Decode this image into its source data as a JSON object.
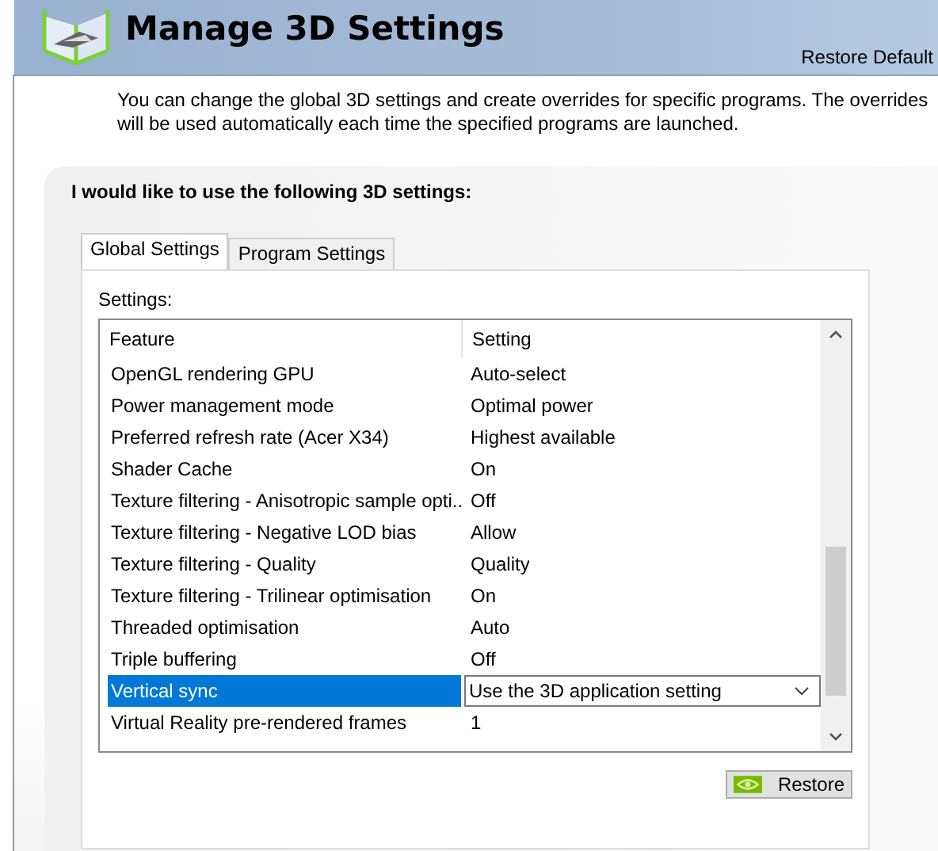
{
  "header": {
    "title": "Manage 3D Settings",
    "restore_link": "Restore Default"
  },
  "description": "You can change the global 3D settings and create overrides for specific programs. The overrides will be used automatically each time the specified programs are launched.",
  "panel": {
    "heading": "I would like to use the following 3D settings:",
    "tabs": [
      {
        "label": "Global Settings",
        "selected": true
      },
      {
        "label": "Program Settings",
        "selected": false
      }
    ],
    "settings_label": "Settings:",
    "columns": [
      "Feature",
      "Setting"
    ],
    "rows": [
      {
        "feature": "OpenGL rendering GPU",
        "setting": "Auto-select",
        "selected": false
      },
      {
        "feature": "Power management mode",
        "setting": "Optimal power",
        "selected": false
      },
      {
        "feature": "Preferred refresh rate (Acer X34)",
        "setting": "Highest available",
        "selected": false
      },
      {
        "feature": "Shader Cache",
        "setting": "On",
        "selected": false
      },
      {
        "feature": "Texture filtering - Anisotropic sample opti...",
        "setting": "Off",
        "selected": false
      },
      {
        "feature": "Texture filtering - Negative LOD bias",
        "setting": "Allow",
        "selected": false
      },
      {
        "feature": "Texture filtering - Quality",
        "setting": "Quality",
        "selected": false
      },
      {
        "feature": "Texture filtering - Trilinear optimisation",
        "setting": "On",
        "selected": false
      },
      {
        "feature": "Threaded optimisation",
        "setting": "Auto",
        "selected": false
      },
      {
        "feature": "Triple buffering",
        "setting": "Off",
        "selected": false
      },
      {
        "feature": "Vertical sync",
        "setting": "Use the 3D application setting",
        "selected": true
      },
      {
        "feature": "Virtual Reality pre-rendered frames",
        "setting": "1",
        "selected": false
      }
    ],
    "restore_button": "Restore"
  }
}
